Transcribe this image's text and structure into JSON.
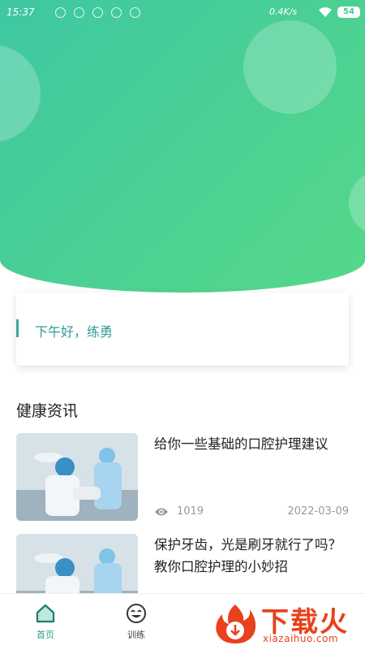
{
  "status_bar": {
    "time": "15:37",
    "net_speed": "0.4K/s",
    "battery": "54",
    "icons": [
      "notification-icon",
      "notification-icon",
      "notification-icon",
      "notification-icon",
      "notification-icon"
    ]
  },
  "colors": {
    "accent": "#2f9c94",
    "header_gradient_start": "#3fc7a3",
    "header_gradient_end": "#55d88a",
    "watermark": "#e8411c"
  },
  "greeting": {
    "text": "下午好，练勇"
  },
  "news": {
    "section_title": "健康资讯",
    "items": [
      {
        "title": "给你一些基础的口腔护理建议",
        "views": "1019",
        "date": "2022-03-09"
      },
      {
        "title": "保护牙齿，光是刷牙就行了吗？教你口腔护理的小妙招",
        "views": "",
        "date": ""
      }
    ]
  },
  "bottom_nav": {
    "items": [
      {
        "label": "首页",
        "icon": "home-icon",
        "active": true
      },
      {
        "label": "训练",
        "icon": "smiley-icon",
        "active": false
      }
    ]
  },
  "watermark": {
    "text": "下载火",
    "url": "xiazaihuo.com"
  }
}
